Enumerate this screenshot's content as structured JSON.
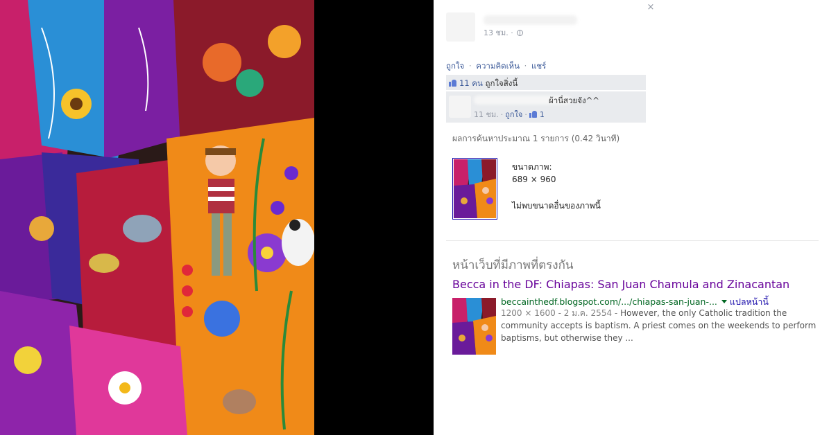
{
  "photo": {
    "description_icon": "embroidered-textile-photo"
  },
  "sidebar": {
    "close_label": "×",
    "post_time": "13 ชม.",
    "actions": {
      "like": "ถูกใจ",
      "comment": "ความคิดเห็น",
      "share": "แชร์",
      "separator": "·"
    },
    "likes": {
      "count": "11 คน",
      "text": "ถูกใจสิ่งนี้"
    },
    "comment": {
      "text": "ผ้านี่สวยจัง^^",
      "time": "11 ชม.",
      "like_link": "ถูกใจ",
      "like_count": "1"
    },
    "results_stats": "ผลการค้นหาประมาณ 1 รายการ (0.42 วินาที)",
    "image_info": {
      "size_label": "ขนาดภาพ:",
      "size_value": "689 × 960",
      "other_sizes": "ไม่พบขนาดอื่นของภาพนี้"
    }
  },
  "search": {
    "section_title": "หน้าเว็บที่มีภาพที่ตรงกัน",
    "result": {
      "title": "Becca in the DF: Chiapas: San Juan Chamula and Zinacantan",
      "url": "beccainthedf.blogspot.com/.../chiapas-san-juan-...",
      "translate": "แปลหน้านี้",
      "date": "1200 × 1600 - 2 ม.ค. 2554 -",
      "snippet": "However, the only Catholic tradition the community accepts is baptism. A priest comes on the weekends to perform baptisms, but otherwise they ..."
    }
  },
  "colors": {
    "link_blue": "#3b5998",
    "google_title": "#660099",
    "google_url": "#006621",
    "panel_gray": "#e9ebee"
  }
}
